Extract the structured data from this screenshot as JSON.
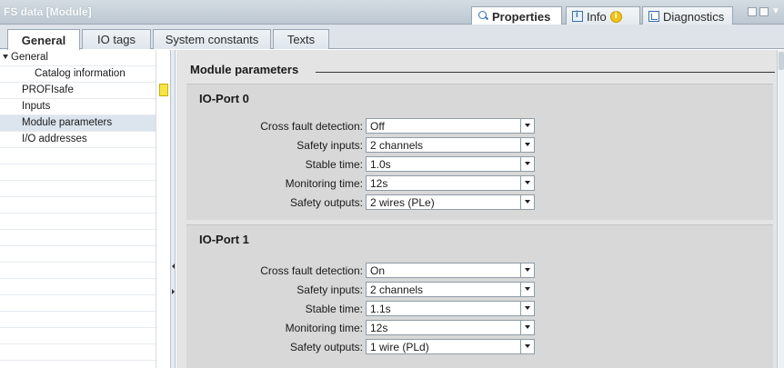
{
  "window": {
    "title": "FS data [Module]"
  },
  "title_tabs": [
    {
      "label": "Properties",
      "icon": "magnifier-icon",
      "active": true
    },
    {
      "label": "Info",
      "icon": "info-icon",
      "active": false
    },
    {
      "label": "Diagnostics",
      "icon": "diagnostics-icon",
      "active": false
    }
  ],
  "tabs": [
    {
      "label": "General",
      "active": true
    },
    {
      "label": "IO tags",
      "active": false
    },
    {
      "label": "System constants",
      "active": false
    },
    {
      "label": "Texts",
      "active": false
    }
  ],
  "tree": [
    {
      "label": "General",
      "expanded": true,
      "indent": 0
    },
    {
      "label": "Catalog information",
      "indent": 1
    },
    {
      "label": "PROFIsafe",
      "indent": 0,
      "warning": true
    },
    {
      "label": "Inputs",
      "indent": 0
    },
    {
      "label": "Module parameters",
      "indent": 0,
      "selected": true
    },
    {
      "label": "I/O addresses",
      "indent": 0
    }
  ],
  "section": {
    "title": "Module parameters"
  },
  "ports": [
    {
      "title": "IO-Port 0",
      "params": [
        {
          "label": "Cross fault detection:",
          "value": "Off"
        },
        {
          "label": "Safety inputs:",
          "value": "2 channels"
        },
        {
          "label": "Stable time:",
          "value": "1.0s"
        },
        {
          "label": "Monitoring time:",
          "value": "12s"
        },
        {
          "label": "Safety outputs:",
          "value": "2 wires (PLe)"
        }
      ]
    },
    {
      "title": "IO-Port 1",
      "params": [
        {
          "label": "Cross fault detection:",
          "value": "On"
        },
        {
          "label": "Safety inputs:",
          "value": "2 channels"
        },
        {
          "label": "Stable time:",
          "value": "1.1s"
        },
        {
          "label": "Monitoring time:",
          "value": "12s"
        },
        {
          "label": "Safety outputs:",
          "value": "1 wire (PLd)"
        }
      ]
    }
  ],
  "colors": {
    "warning": "#f7e547",
    "selection": "#dce4ee",
    "panel": "#d8d8d8"
  }
}
